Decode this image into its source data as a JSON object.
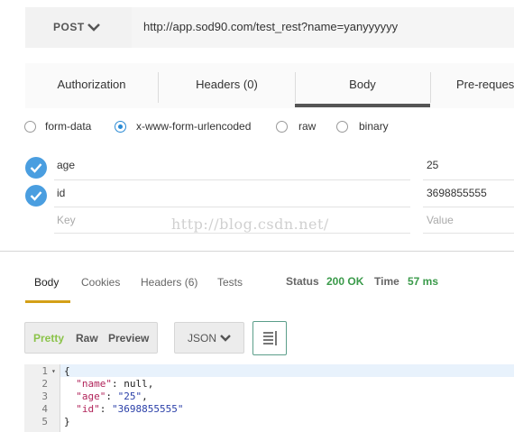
{
  "request": {
    "method": "POST",
    "method_icon": "chevron-down-icon",
    "url": "http://app.sod90.com/test_rest?name=yanyyyyyy"
  },
  "request_tabs": [
    {
      "label": "Authorization",
      "active": false
    },
    {
      "label": "Headers (0)",
      "active": false
    },
    {
      "label": "Body",
      "active": true
    },
    {
      "label": "Pre-reques",
      "active": false
    }
  ],
  "body_types": [
    {
      "label": "form-data",
      "checked": false
    },
    {
      "label": "x-www-form-urlencoded",
      "checked": true
    },
    {
      "label": "raw",
      "checked": false
    },
    {
      "label": "binary",
      "checked": false
    }
  ],
  "params": [
    {
      "key": "age",
      "value": "25",
      "enabled": true
    },
    {
      "key": "id",
      "value": "3698855555",
      "enabled": true
    }
  ],
  "param_placeholders": {
    "key": "Key",
    "value": "Value"
  },
  "watermark": "http://blog.csdn.net/",
  "response_tabs": [
    {
      "label": "Body",
      "active": true
    },
    {
      "label": "Cookies",
      "active": false
    },
    {
      "label": "Headers (6)",
      "active": false
    },
    {
      "label": "Tests",
      "active": false
    }
  ],
  "status": {
    "label": "Status",
    "value": "200 OK"
  },
  "time": {
    "label": "Time",
    "value": "57 ms"
  },
  "view_modes": [
    {
      "label": "Pretty",
      "active": true
    },
    {
      "label": "Raw",
      "active": false
    },
    {
      "label": "Preview",
      "active": false
    }
  ],
  "format": {
    "selected": "JSON",
    "icon": "chevron-down-icon"
  },
  "wrap_icon": "text-wrap-icon",
  "code": {
    "line_numbers": [
      "1",
      "2",
      "3",
      "4",
      "5"
    ],
    "open_brace": "{",
    "close_brace": "}",
    "fields": [
      {
        "key": "\"name\"",
        "sep": ": ",
        "value": "null",
        "comma": ","
      },
      {
        "key": "\"age\"",
        "sep": ": ",
        "value": "\"25\"",
        "comma": ","
      },
      {
        "key": "\"id\"",
        "sep": ": ",
        "value": "\"3698855555\"",
        "comma": ""
      }
    ]
  },
  "colors": {
    "accent": "#2a8ad4",
    "status_ok": "#3a9a4a",
    "tab_underline": "#d4a017",
    "pretty_active": "#8bc34a"
  }
}
